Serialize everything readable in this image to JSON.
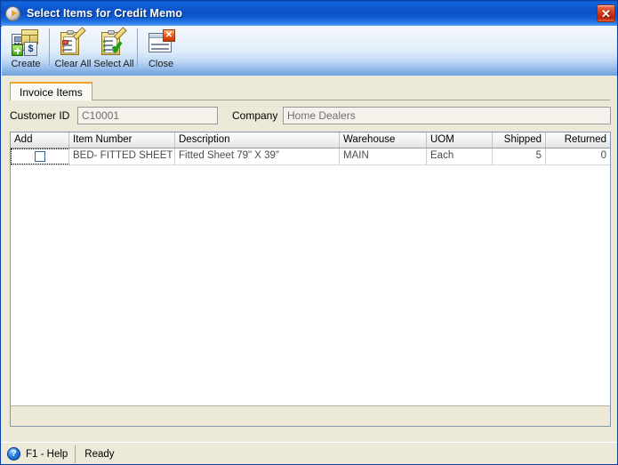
{
  "window": {
    "title": "Select Items for Credit Memo",
    "title_icon": "play-circle-icon",
    "close_label": "✕"
  },
  "toolbar": {
    "buttons": [
      {
        "label": "Create",
        "icon": "create-invoice-icon"
      },
      {
        "label": "Clear All",
        "icon": "clear-all-clipboard-icon"
      },
      {
        "label": "Select All",
        "icon": "select-all-clipboard-icon"
      },
      {
        "label": "Close",
        "icon": "close-window-icon"
      }
    ]
  },
  "tabs": [
    {
      "label": "Invoice Items",
      "active": true
    }
  ],
  "fields": {
    "customer_id": {
      "label": "Customer ID",
      "value": "C10001"
    },
    "company": {
      "label": "Company",
      "value": "Home Dealers"
    }
  },
  "grid": {
    "columns": [
      {
        "key": "add",
        "label": "Add",
        "align": "left"
      },
      {
        "key": "item_number",
        "label": "Item Number",
        "align": "left"
      },
      {
        "key": "description",
        "label": "Description",
        "align": "left"
      },
      {
        "key": "warehouse",
        "label": "Warehouse",
        "align": "left"
      },
      {
        "key": "uom",
        "label": "UOM",
        "align": "left"
      },
      {
        "key": "shipped",
        "label": "Shipped",
        "align": "right"
      },
      {
        "key": "returned",
        "label": "Returned",
        "align": "right"
      }
    ],
    "rows": [
      {
        "add": false,
        "item_number": "BED- FITTED SHEET",
        "description": "Fitted Sheet 79\" X 39\"",
        "warehouse": "MAIN",
        "uom": "Each",
        "shipped": "5",
        "returned": "0"
      }
    ]
  },
  "statusbar": {
    "help_icon": "question-mark-icon",
    "help_label": "F1 - Help",
    "status": "Ready"
  },
  "colors": {
    "titlebar_blue": "#0b50c4",
    "tab_accent_orange": "#f0a32a",
    "client_beige": "#ece9d8",
    "close_red": "#cf3113"
  }
}
